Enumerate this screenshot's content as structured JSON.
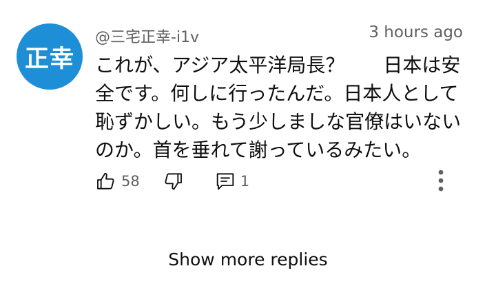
{
  "comment": {
    "avatar_text": "正幸",
    "author": "@三宅正幸-i1v",
    "timestamp": "3 hours ago",
    "text": "これが、アジア太平洋局長？　　日本は安全です。何しに行ったんだ。日本人として恥ずかしい。もう少しましな官僚はいないのか。首を垂れて謝っているみたい。",
    "likes": "58",
    "replies": "1",
    "avatar_color": "#1e8fd6"
  },
  "icons": {
    "like": "thumb-up-icon",
    "dislike": "thumb-down-icon",
    "reply": "comment-icon",
    "more": "more-vert-icon"
  },
  "footer": {
    "show_more_label": "Show more replies"
  }
}
